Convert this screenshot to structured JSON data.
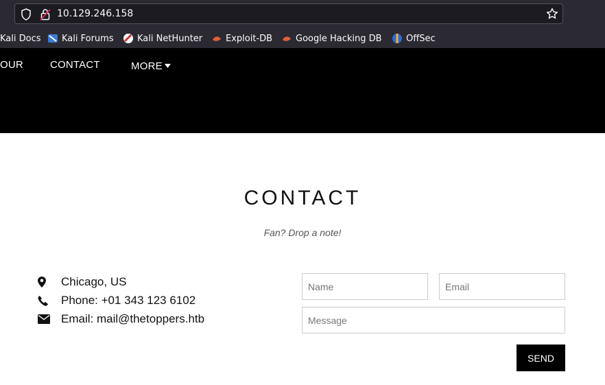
{
  "browser": {
    "url": "10.129.246.158",
    "bookmarks": [
      {
        "label": "Kali Docs"
      },
      {
        "label": "Kali Forums"
      },
      {
        "label": "Kali NetHunter"
      },
      {
        "label": "Exploit-DB"
      },
      {
        "label": "Google Hacking DB"
      },
      {
        "label": "OffSec"
      }
    ]
  },
  "nav": {
    "items": [
      "OUR",
      "CONTACT",
      "MORE"
    ]
  },
  "contact": {
    "title": "CONTACT",
    "subtitle": "Fan? Drop a note!",
    "info": {
      "location": "Chicago, US",
      "phone": "Phone: +01 343 123 6102",
      "email": "Email: mail@thetoppers.htb"
    },
    "form": {
      "name_placeholder": "Name",
      "email_placeholder": "Email",
      "message_placeholder": "Message",
      "send_label": "SEND"
    }
  },
  "colors": {
    "navbar_bg": "#000000",
    "chrome_bg": "#2b2a33",
    "send_bg": "#000000"
  }
}
